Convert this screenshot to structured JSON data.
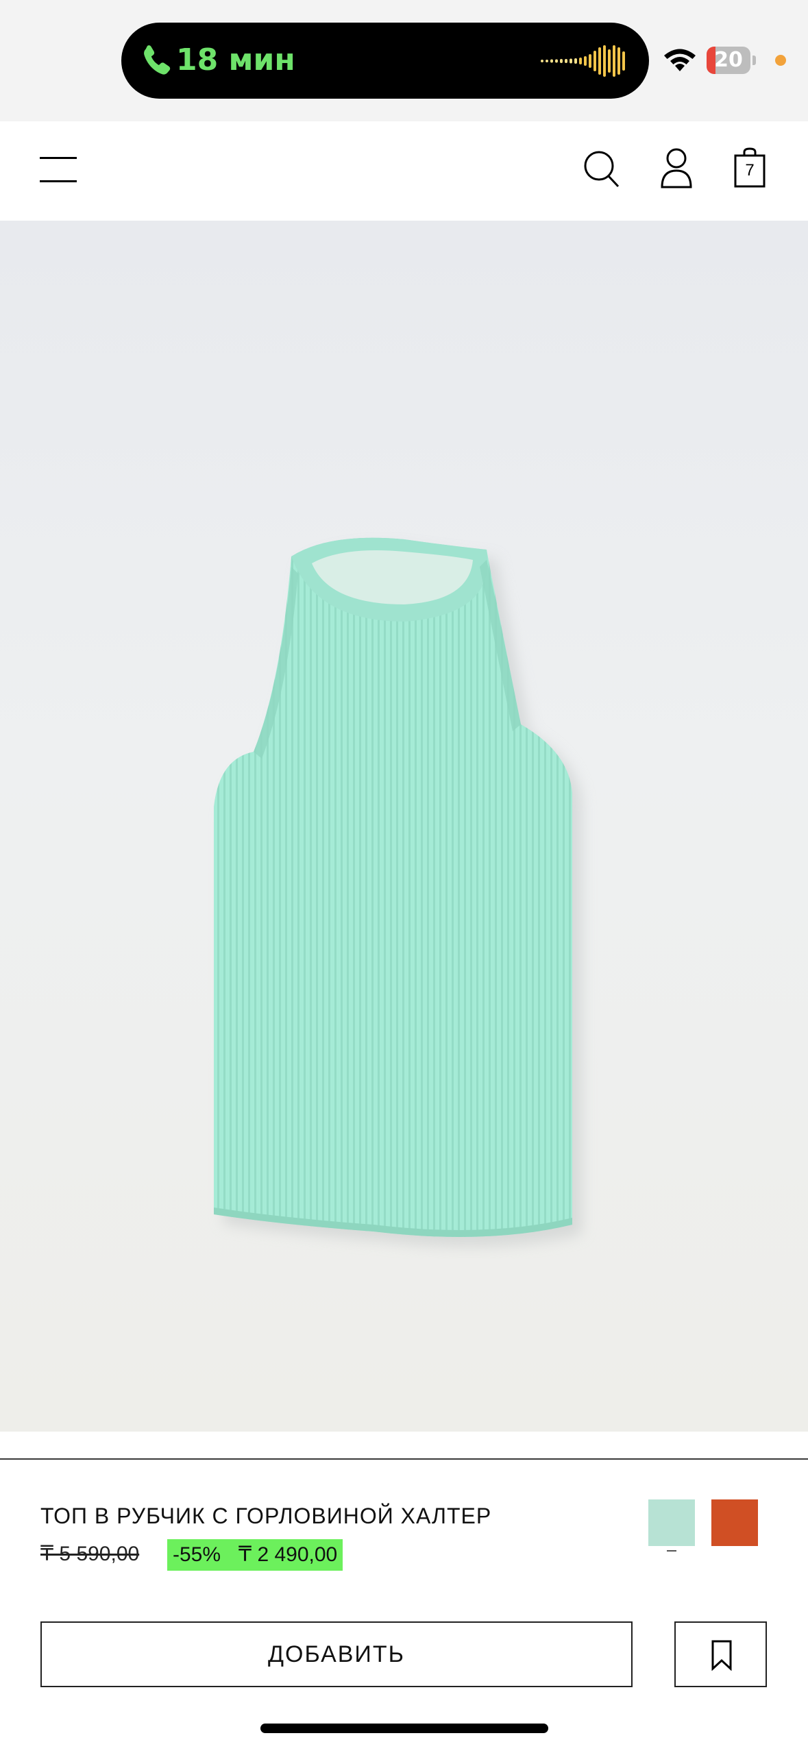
{
  "status_bar": {
    "call_duration": "18 мин",
    "battery_level": "20",
    "battery_fraction": 0.2,
    "call_color": "#6ee26a",
    "privacy_dot_color": "#f2a23a"
  },
  "header": {
    "icons": [
      "menu-icon",
      "search-icon",
      "account-icon",
      "shopping-bag-icon"
    ],
    "bag_count": "7"
  },
  "product": {
    "name": "ТОП В РУБЧИК С ГОРЛОВИНОЙ ХАЛТЕР",
    "price_old": "₸ 5 590,00",
    "discount": "-55%",
    "price_new": "₸ 2 490,00",
    "sale_highlight_color": "#6cf05c",
    "colors": [
      {
        "name": "mint",
        "hex": "#b7e2d4",
        "selected": true
      },
      {
        "name": "orange",
        "hex": "#d04f24",
        "selected": false
      }
    ]
  },
  "actions": {
    "add_label": "ДОБАВИТЬ",
    "save_icon": "bookmark-icon",
    "accessibility_icon": "accessibility-icon"
  }
}
